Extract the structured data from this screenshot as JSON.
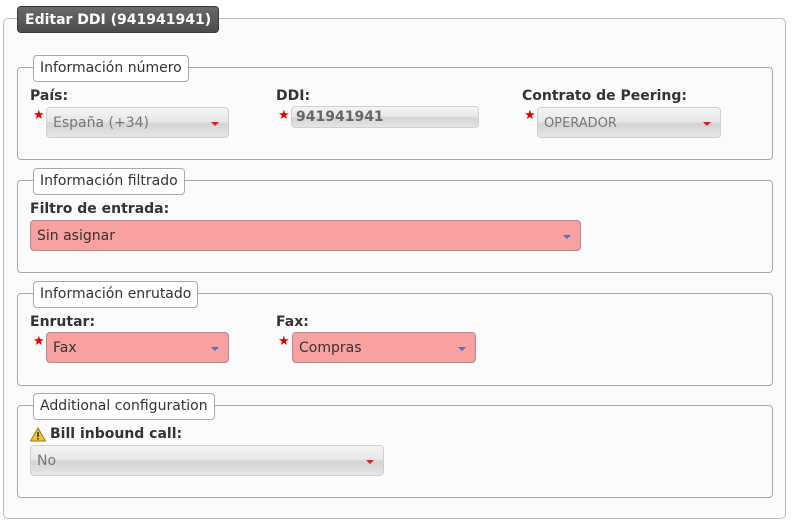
{
  "form_title": "Editar DDI (941941941)",
  "sections": {
    "numero": {
      "legend": "Información número",
      "pais_label": "País:",
      "pais_value": "España (+34)",
      "ddi_label": "DDI:",
      "ddi_value": "941941941",
      "peering_label": "Contrato de Peering:",
      "peering_value": "OPERADOR"
    },
    "filtrado": {
      "legend": "Información filtrado",
      "filtro_label": "Filtro de entrada:",
      "filtro_value": "Sin asignar"
    },
    "enrutado": {
      "legend": "Información enrutado",
      "enrutar_label": "Enrutar:",
      "enrutar_value": "Fax",
      "fax_label": "Fax:",
      "fax_value": "Compras"
    },
    "additional": {
      "legend": "Additional configuration",
      "bill_label": "Bill inbound call:",
      "bill_value": "No"
    }
  },
  "required_marker": "*",
  "colors": {
    "required": "#dd0000",
    "invalid_field": "#f9a0a0",
    "title_tab": "#555555"
  },
  "icons": {
    "warning": "warning-icon",
    "required": "required-star-icon",
    "dropdown": "chevron-down-icon"
  }
}
